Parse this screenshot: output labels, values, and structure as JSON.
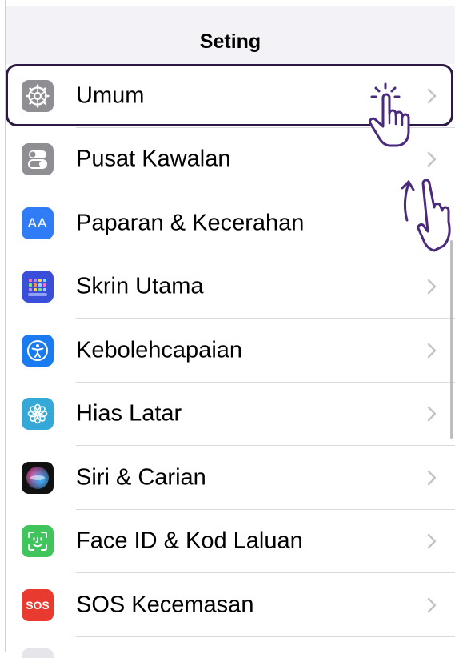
{
  "header": {
    "title": "Seting"
  },
  "rows": [
    {
      "label": "Umum",
      "icon": "gear-icon",
      "icon_bg": "#8e8e93"
    },
    {
      "label": "Pusat Kawalan",
      "icon": "toggles-icon",
      "icon_bg": "#8e8e93"
    },
    {
      "label": "Paparan & Kecerahan",
      "icon": "display-text-icon",
      "icon_text": "AA",
      "icon_bg": "#2f7cf6"
    },
    {
      "label": "Skrin Utama",
      "icon": "home-grid-icon",
      "icon_bg": "#3a4fd9"
    },
    {
      "label": "Kebolehcapaian",
      "icon": "accessibility-icon",
      "icon_bg": "#1a7bf0"
    },
    {
      "label": "Hias Latar",
      "icon": "flower-icon",
      "icon_bg": "#34a9d8"
    },
    {
      "label": "Siri & Carian",
      "icon": "siri-icon",
      "icon_bg": "#111111"
    },
    {
      "label": "Face ID & Kod Laluan",
      "icon": "face-id-icon",
      "icon_bg": "#3fc55c"
    },
    {
      "label": "SOS Kecemasan",
      "icon": "sos-icon",
      "icon_text": "SOS",
      "icon_bg": "#e93a30"
    }
  ],
  "colors": {
    "highlight": "#2c1a45",
    "gesture": "#4a2a7a"
  }
}
